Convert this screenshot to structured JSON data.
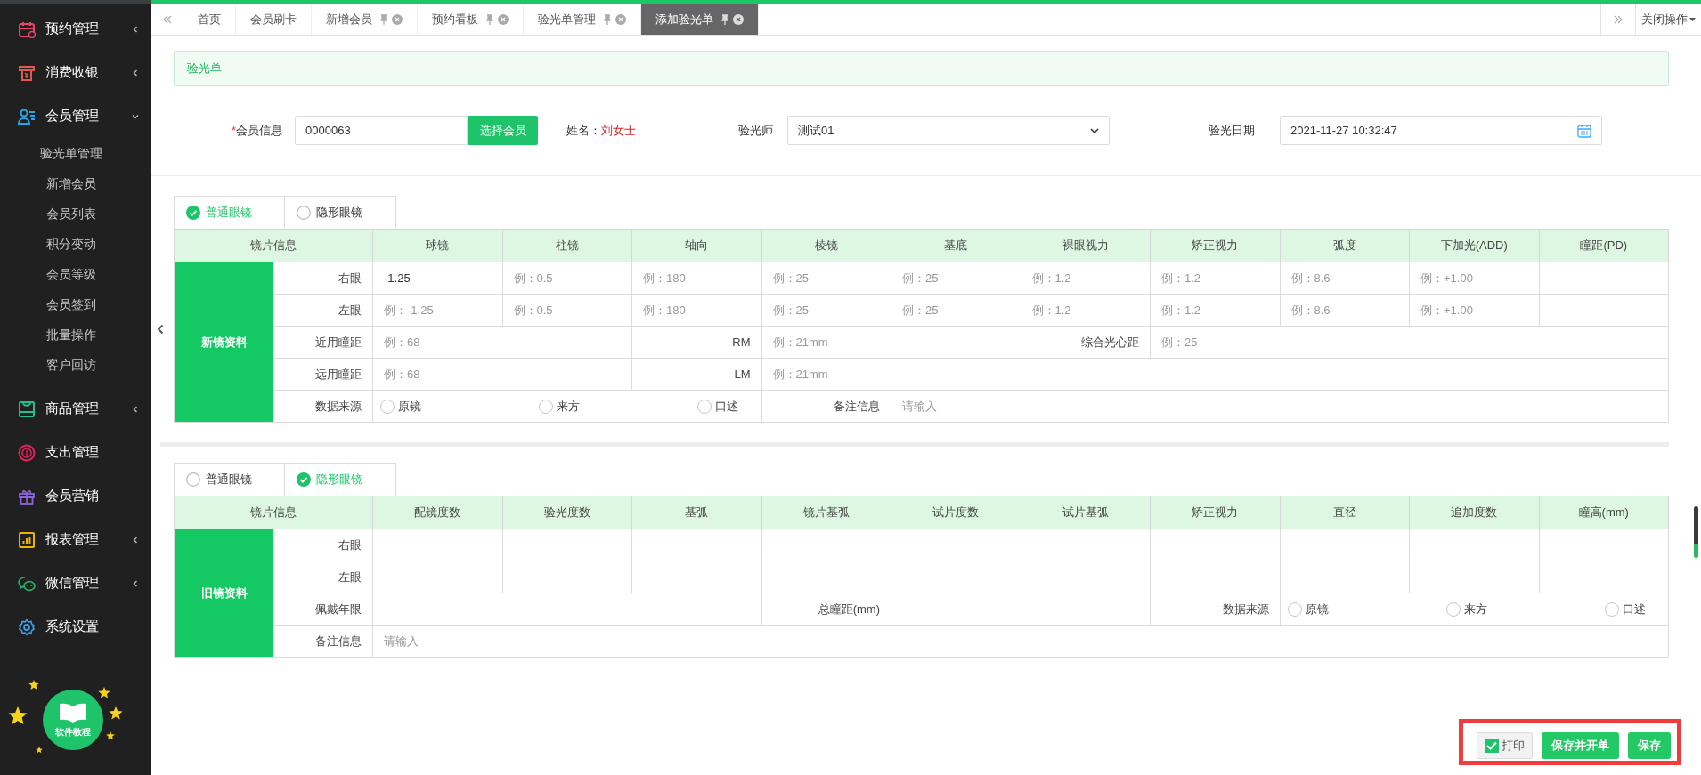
{
  "sidebar": {
    "menu": [
      {
        "label": "预约管理",
        "expandable": true,
        "expanded": false
      },
      {
        "label": "消费收银",
        "expandable": true,
        "expanded": false
      },
      {
        "label": "会员管理",
        "expandable": true,
        "expanded": true,
        "children": [
          {
            "label": "验光单管理"
          },
          {
            "label": "新增会员"
          },
          {
            "label": "会员列表"
          },
          {
            "label": "积分变动"
          },
          {
            "label": "会员等级"
          },
          {
            "label": "会员签到"
          },
          {
            "label": "批量操作"
          },
          {
            "label": "客户回访"
          }
        ]
      },
      {
        "label": "商品管理",
        "expandable": true,
        "expanded": false
      },
      {
        "label": "支出管理",
        "expandable": false
      },
      {
        "label": "会员营销",
        "expandable": false
      },
      {
        "label": "报表管理",
        "expandable": true,
        "expanded": false
      },
      {
        "label": "微信管理",
        "expandable": true,
        "expanded": false
      },
      {
        "label": "系统设置",
        "expandable": false
      }
    ],
    "help": {
      "label": "软件教程"
    }
  },
  "tab_bar": {
    "tabs": [
      {
        "label": "首页",
        "closable": false,
        "selected": false
      },
      {
        "label": "会员刷卡",
        "closable": false,
        "selected": false
      },
      {
        "label": "新增会员",
        "closable": true,
        "selected": false
      },
      {
        "label": "预约看板",
        "closable": true,
        "selected": false
      },
      {
        "label": "验光单管理",
        "closable": true,
        "selected": false
      },
      {
        "label": "添加验光单",
        "closable": true,
        "selected": true
      }
    ],
    "close_menu": "关闭操作"
  },
  "panel": {
    "title": "验光单"
  },
  "form": {
    "member": {
      "required_mark": "*",
      "label": "会员信息",
      "value": "0000063",
      "button": "选择会员"
    },
    "name": {
      "label": "姓名：",
      "value": "刘女士"
    },
    "optometrist": {
      "label": "验光师",
      "value": "测试01"
    },
    "date": {
      "label": "验光日期",
      "value": "2021-11-27 10:32:47"
    }
  },
  "sections": [
    {
      "tabs": [
        {
          "label": "普通眼镜",
          "selected": true
        },
        {
          "label": "隐形眼镜",
          "selected": false
        }
      ],
      "title": "新镜资料",
      "info_header": "镜片信息",
      "columns": [
        "球镜",
        "柱镜",
        "轴向",
        "棱镜",
        "基底",
        "裸眼视力",
        "矫正视力",
        "弧度",
        "下加光(ADD)",
        "瞳距(PD)"
      ],
      "rows": [
        {
          "label": "右眼",
          "cells": [
            {
              "value": "-1.25"
            },
            {
              "placeholder": "例：0.5"
            },
            {
              "placeholder": "例：180"
            },
            {
              "placeholder": "例：25"
            },
            {
              "placeholder": "例：25"
            },
            {
              "placeholder": "例：1.2"
            },
            {
              "placeholder": "例：1.2"
            },
            {
              "placeholder": "例：8.6"
            },
            {
              "placeholder": "例：+1.00"
            },
            {}
          ]
        },
        {
          "label": "左眼",
          "cells": [
            {
              "placeholder": "例：-1.25"
            },
            {
              "placeholder": "例：0.5"
            },
            {
              "placeholder": "例：180"
            },
            {
              "placeholder": "例：25"
            },
            {
              "placeholder": "例：25"
            },
            {
              "placeholder": "例：1.2"
            },
            {
              "placeholder": "例：1.2"
            },
            {
              "placeholder": "例：8.6"
            },
            {
              "placeholder": "例：+1.00"
            },
            {}
          ]
        }
      ],
      "details": [
        {
          "label": "近用瞳距",
          "fields": [
            {
              "kind": "input",
              "placeholder": "例：68"
            },
            {
              "kind": "label",
              "text": "RM"
            },
            {
              "kind": "input",
              "placeholder": "例：21mm"
            },
            {
              "kind": "label",
              "text": "综合光心距"
            },
            {
              "kind": "input",
              "placeholder": "例：25"
            }
          ]
        },
        {
          "label": "远用瞳距",
          "fields": [
            {
              "kind": "input",
              "placeholder": "例：68"
            },
            {
              "kind": "label",
              "text": "LM"
            },
            {
              "kind": "input",
              "placeholder": "例：21mm"
            }
          ]
        },
        {
          "label": "数据来源",
          "fields": [
            {
              "kind": "radios",
              "options": [
                {
                  "label": "原镜",
                  "selected": false
                },
                {
                  "label": "来方",
                  "selected": false
                },
                {
                  "label": "口述",
                  "selected": false
                }
              ]
            },
            {
              "kind": "label",
              "text": "备注信息"
            },
            {
              "kind": "input",
              "placeholder": "请输入"
            }
          ]
        }
      ]
    },
    {
      "tabs": [
        {
          "label": "普通眼镜",
          "selected": false
        },
        {
          "label": "隐形眼镜",
          "selected": true
        }
      ],
      "title": "旧镜资料",
      "info_header": "镜片信息",
      "columns": [
        "配镜度数",
        "验光度数",
        "基弧",
        "镜片基弧",
        "试片度数",
        "试片基弧",
        "矫正视力",
        "直径",
        "追加度数",
        "瞳高(mm)"
      ],
      "rows": [
        {
          "label": "右眼",
          "cells": [
            {},
            {},
            {},
            {},
            {},
            {},
            {},
            {},
            {},
            {}
          ]
        },
        {
          "label": "左眼",
          "cells": [
            {},
            {},
            {},
            {},
            {},
            {},
            {},
            {},
            {},
            {}
          ]
        }
      ],
      "details": [
        {
          "label": "佩戴年限",
          "fields": [
            {
              "kind": "input"
            },
            {
              "kind": "label",
              "text": "总瞳距(mm)"
            },
            {
              "kind": "input"
            },
            {
              "kind": "label",
              "text": "数据来源"
            },
            {
              "kind": "radios",
              "options": [
                {
                  "label": "原镜",
                  "selected": false
                },
                {
                  "label": "来方",
                  "selected": false
                },
                {
                  "label": "口述",
                  "selected": false
                }
              ]
            }
          ]
        },
        {
          "label": "备注信息",
          "fields": [
            {
              "kind": "input",
              "placeholder": "请输入"
            }
          ]
        }
      ]
    }
  ],
  "footer": {
    "print": {
      "label": "打印",
      "checked": true
    },
    "buttons": [
      "保存并开单",
      "保存"
    ]
  }
}
